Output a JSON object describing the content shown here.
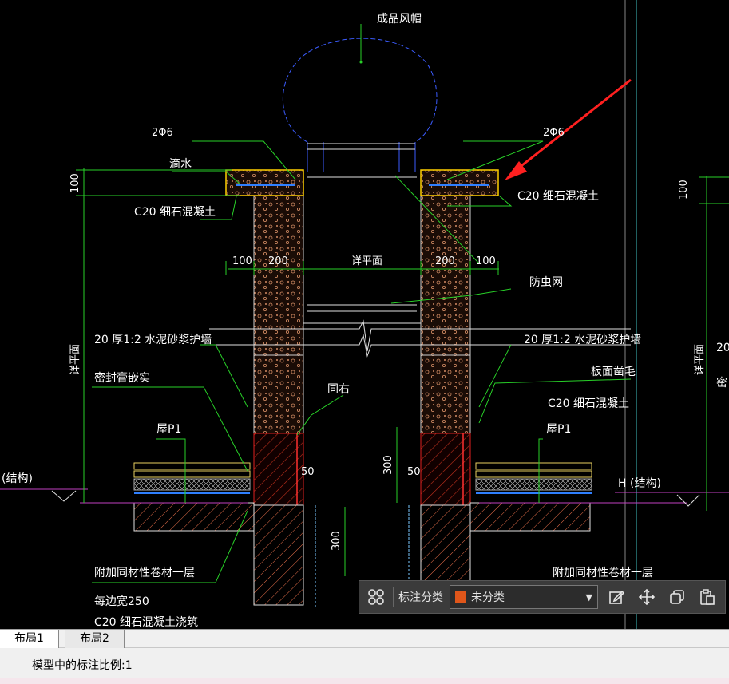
{
  "drawing": {
    "labels": {
      "cap": "成品风帽",
      "rebar_left": "2Φ6",
      "rebar_right": "2Φ6",
      "drip": "滴水",
      "c20_left": "C20  细石混凝土",
      "c20_right": "C20  细石混凝土",
      "dim_100_vert": "100",
      "dim_100_left": "100",
      "dim_200_left": "200",
      "dim_200_right": "200",
      "dim_100_right": "100",
      "flat_label": "详平面",
      "insect_net": "防虫网",
      "plaster_left": "20  厚1:2  水泥砂浆护墙",
      "plaster_right": "20  厚1:2  水泥砂浆护墙",
      "sealant": "密封膏嵌实",
      "same_right": "同右",
      "board_rough": "板面凿毛",
      "c20_right2": "C20  细石混凝土",
      "roof_p1_left": "屋P1",
      "roof_p1_right": "屋P1",
      "dim_50_left": "50",
      "dim_50_right": "50",
      "dim_300_a": "300",
      "dim_300_b": "300",
      "struct_left": "(结构)",
      "struct_right": "H (结构)",
      "extra_layer": "附加同材性卷材一层",
      "extra_layer_right": "附加同材性卷材一层",
      "each_width": "每边宽250",
      "c20_pour": "C20  细石混凝土浇筑",
      "vert_label_left": "详平面",
      "vert_label_right": "详平面",
      "edge_20": "20",
      "edge_mi": "密"
    }
  },
  "toolbar": {
    "label": "标注分类",
    "selected": "未分类",
    "swatch_color": "#e0561a"
  },
  "tabs": [
    {
      "label": "布局1"
    },
    {
      "label": "布局2"
    }
  ],
  "status": {
    "text": "模型中的标注比例:1"
  }
}
